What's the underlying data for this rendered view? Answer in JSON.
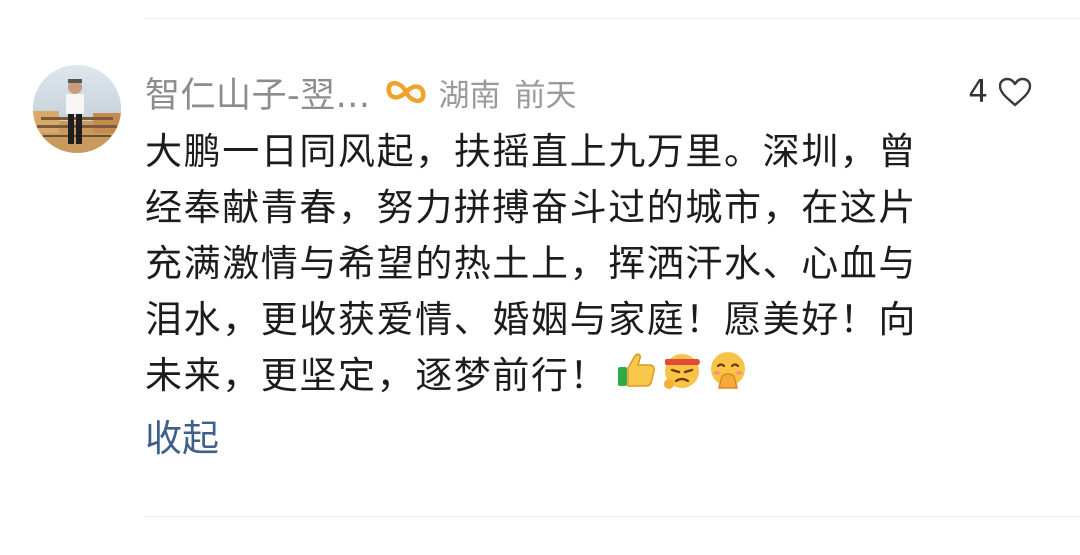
{
  "comment": {
    "user": {
      "name": "智仁山子-翌...",
      "location": "湖南",
      "time": "前天"
    },
    "likes": {
      "count": "4"
    },
    "text_lines": [
      "大鹏一日同风起，扶摇直上九万里。深圳，曾",
      "经奉献青春，努力拼搏奋斗过的城市，在这片",
      "充满激情与希望的热土上，挥洒汗水、心血与",
      "泪水，更收获爱情、婚姻与家庭！愿美好！向",
      "未来，更坚定，逐梦前行！"
    ],
    "emojis": [
      "thumbs-up-icon",
      "determined-face-headband-icon",
      "face-with-hand-over-mouth-icon"
    ],
    "collapse_label": "收起"
  },
  "colors": {
    "link": "#3e5f8a",
    "meta_gray": "#9a9a9a",
    "badge_orange": "#f0a32a"
  }
}
